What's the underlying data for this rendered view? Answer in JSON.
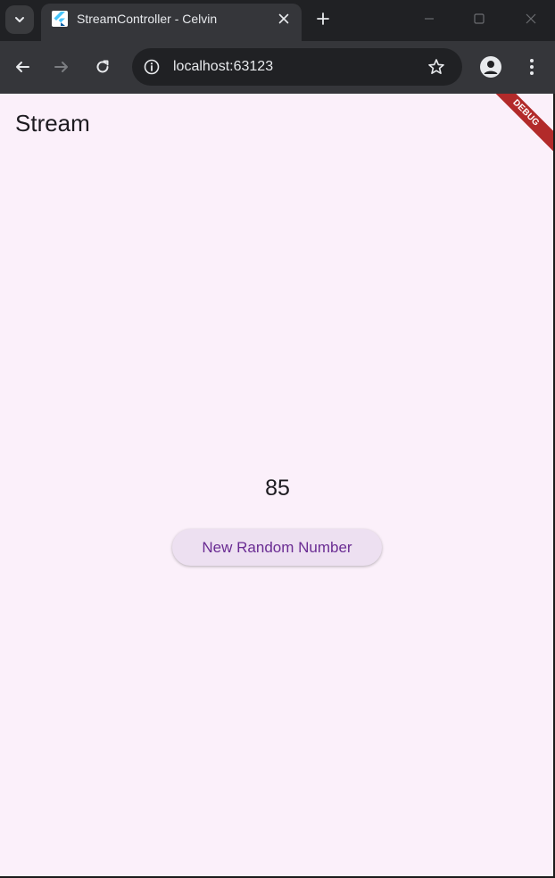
{
  "browser": {
    "tab": {
      "title": "StreamController - Celvin"
    },
    "address_bar": {
      "url": "localhost:63123"
    }
  },
  "app": {
    "appbar_title": "Stream",
    "debug_banner": "DEBUG",
    "number_display": "85",
    "button_label": "New Random Number"
  },
  "colors": {
    "page_background": "#fbf0fa",
    "button_background": "#ede0f1",
    "button_text": "#6a2c93",
    "debug_banner": "#b22a2a",
    "browser_chrome": "#35363a"
  },
  "icons": {
    "tab_search": "chevron-down-icon",
    "favicon": "flutter-icon",
    "tab_close": "close-icon",
    "new_tab": "plus-icon",
    "minimize": "minimize-icon",
    "maximize": "maximize-icon",
    "window_close": "close-icon",
    "back": "arrow-left-icon",
    "forward": "arrow-right-icon",
    "reload": "reload-icon",
    "site_info": "info-icon",
    "bookmark": "star-icon",
    "profile": "person-icon",
    "menu": "kebab-menu-icon"
  }
}
